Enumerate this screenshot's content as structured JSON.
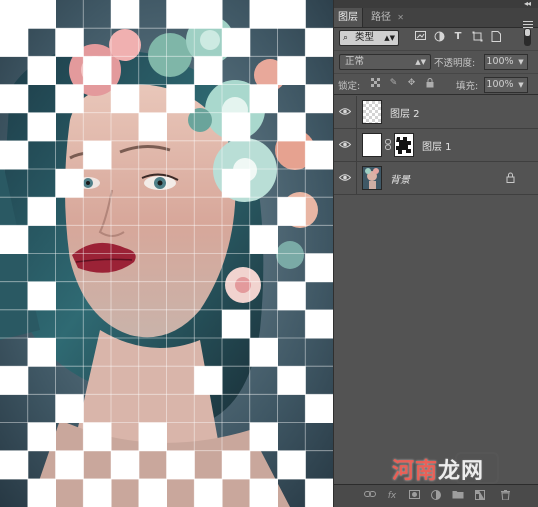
{
  "panel": {
    "tabs": [
      {
        "label": "图层",
        "active": true
      },
      {
        "label": "路径",
        "active": false
      }
    ],
    "filter": {
      "kind_label": "类型",
      "icons": [
        "image-filter-icon",
        "adjustment-filter-icon",
        "type-filter-icon",
        "shape-filter-icon",
        "smart-object-filter-icon"
      ]
    },
    "blend_mode": "正常",
    "opacity_label": "不透明度:",
    "opacity_value": "100%",
    "lock_label": "锁定:",
    "fill_label": "填充:",
    "fill_value": "100%",
    "layers": [
      {
        "name": "图层 2",
        "thumb": "checker",
        "visible": true,
        "has_mask": false,
        "locked": false,
        "italic": false
      },
      {
        "name": "图层 1",
        "thumb": "white",
        "visible": true,
        "has_mask": true,
        "locked": false,
        "italic": false
      },
      {
        "name": "背景",
        "thumb": "portrait",
        "visible": true,
        "has_mask": false,
        "locked": true,
        "italic": true
      }
    ],
    "bottom_icons": [
      "link-layers-icon",
      "fx-icon",
      "add-mask-icon",
      "adjustment-layer-icon",
      "group-folder-icon",
      "new-layer-icon",
      "trash-icon"
    ]
  },
  "canvas": {
    "grid": {
      "cols": 12,
      "rows": 18
    },
    "white_tiles": [
      [
        0,
        0
      ],
      [
        0,
        1
      ],
      [
        0,
        4
      ],
      [
        0,
        6
      ],
      [
        0,
        7
      ],
      [
        0,
        9
      ],
      [
        0,
        10
      ],
      [
        1,
        0
      ],
      [
        1,
        2
      ],
      [
        1,
        8
      ],
      [
        1,
        11
      ],
      [
        2,
        1
      ],
      [
        2,
        3
      ],
      [
        2,
        7
      ],
      [
        2,
        10
      ],
      [
        3,
        0
      ],
      [
        3,
        2
      ],
      [
        3,
        4
      ],
      [
        3,
        6
      ],
      [
        3,
        9
      ],
      [
        3,
        11
      ],
      [
        4,
        1
      ],
      [
        4,
        5
      ],
      [
        4,
        8
      ],
      [
        4,
        10
      ],
      [
        5,
        0
      ],
      [
        5,
        3
      ],
      [
        5,
        11
      ],
      [
        6,
        2
      ],
      [
        6,
        8
      ],
      [
        7,
        1
      ],
      [
        7,
        10
      ],
      [
        8,
        0
      ],
      [
        8,
        9
      ],
      [
        9,
        11
      ],
      [
        10,
        1
      ],
      [
        10,
        10
      ],
      [
        11,
        8
      ],
      [
        11,
        11
      ],
      [
        12,
        1
      ],
      [
        12,
        9
      ],
      [
        13,
        0
      ],
      [
        13,
        7
      ],
      [
        13,
        10
      ],
      [
        14,
        2
      ],
      [
        14,
        11
      ],
      [
        15,
        1
      ],
      [
        15,
        3
      ],
      [
        15,
        5
      ],
      [
        15,
        9
      ],
      [
        16,
        0
      ],
      [
        16,
        2
      ],
      [
        16,
        4
      ],
      [
        16,
        6
      ],
      [
        16,
        8
      ],
      [
        16,
        10
      ],
      [
        17,
        1
      ],
      [
        17,
        3
      ],
      [
        17,
        5
      ],
      [
        17,
        7
      ],
      [
        17,
        9
      ],
      [
        17,
        11
      ]
    ]
  },
  "watermark": {
    "text_colored": "河南",
    "text_white": "龙网"
  }
}
